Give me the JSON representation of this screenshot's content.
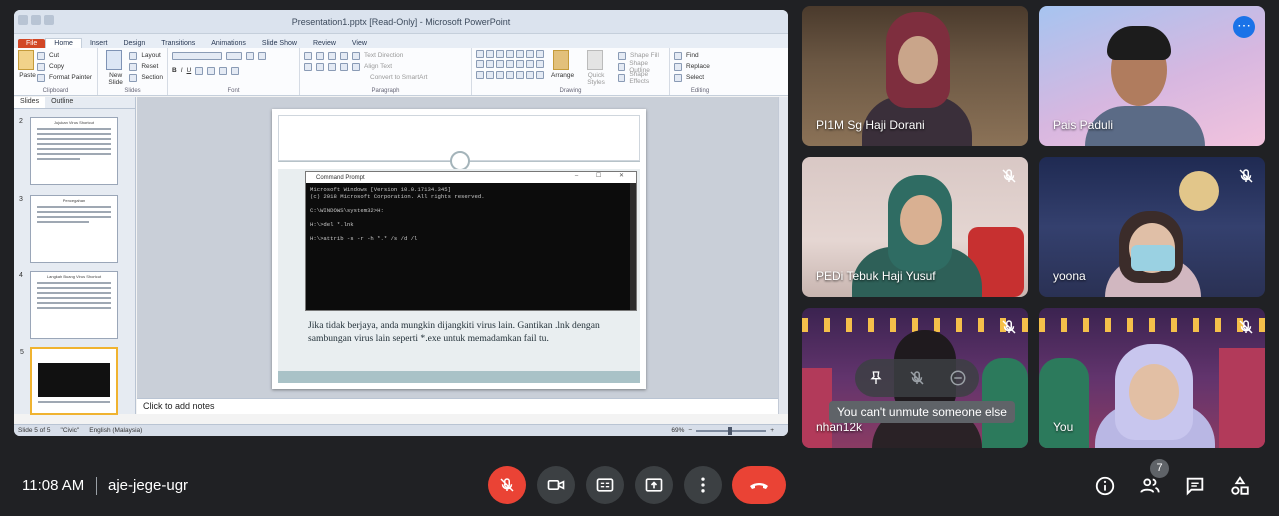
{
  "presentation": {
    "window_title": "Presentation1.pptx [Read-Only] - Microsoft PowerPoint",
    "ribbon_tabs": [
      "File",
      "Home",
      "Insert",
      "Design",
      "Transitions",
      "Animations",
      "Slide Show",
      "Review",
      "View"
    ],
    "groups": {
      "clipboard": {
        "label": "Clipboard",
        "paste": "Paste",
        "cut": "Cut",
        "copy": "Copy",
        "format_painter": "Format Painter"
      },
      "slides": {
        "label": "Slides",
        "new_slide": "New Slide",
        "layout": "Layout",
        "reset": "Reset",
        "section": "Section"
      },
      "font": {
        "label": "Font"
      },
      "paragraph": {
        "label": "Paragraph",
        "text_direction": "Text Direction",
        "align_text": "Align Text",
        "smartart": "Convert to SmartArt"
      },
      "drawing": {
        "label": "Drawing",
        "arrange": "Arrange",
        "quick_styles": "Quick Styles",
        "shape_fill": "Shape Fill",
        "shape_outline": "Shape Outline",
        "shape_effects": "Shape Effects"
      },
      "editing": {
        "label": "Editing",
        "find": "Find",
        "replace": "Replace",
        "select": "Select"
      }
    },
    "pane_tabs": {
      "slides": "Slides",
      "outline": "Outline"
    },
    "thumbnails": [
      {
        "num": "2",
        "title": "Jujukan Virus Shortcut"
      },
      {
        "num": "3",
        "title": "Pencegahan"
      },
      {
        "num": "4",
        "title": "Langkah Buang Virus Shortcut"
      },
      {
        "num": "5",
        "title": ""
      }
    ],
    "cmd": {
      "title": "Command Prompt",
      "controls": "–  ☐  ✕",
      "lines": "Microsoft Windows [Version 10.0.17134.345]\n(c) 2018 Microsoft Corporation. All rights reserved.\n\nC:\\WINDOWS\\system32>H:\n\nH:\\>del *.lnk\n\nH:\\>attrib -s -r -h *.* /s /d /l"
    },
    "slide_caption": "Jika tidak berjaya, anda mungkin dijangkiti virus lain. Gantikan .lnk dengan sambungan virus lain seperti *.exe untuk memadamkan fail tu.",
    "notes_placeholder": "Click to add notes",
    "status": {
      "slide": "Slide 5 of 5",
      "theme": "\"Civic\"",
      "language": "English (Malaysia)",
      "zoom": "69%"
    }
  },
  "participants": [
    {
      "name": "PI1M Sg Haji Dorani",
      "muted": false
    },
    {
      "name": "Pais Paduli",
      "muted": false
    },
    {
      "name": "PEDi Tebuk Haji Yusuf",
      "muted": true
    },
    {
      "name": "yoona",
      "muted": true
    },
    {
      "name": "nhan12k",
      "muted": true
    },
    {
      "name": "You",
      "muted": true
    }
  ],
  "tooltip": "You can't unmute someone else",
  "meeting": {
    "time": "11:08 AM",
    "code": "aje-jege-ugr",
    "participant_count": "7"
  },
  "colors": {
    "bg": "#202124",
    "red": "#ea4335",
    "button": "#3c4043",
    "accent": "#1a73e8"
  }
}
